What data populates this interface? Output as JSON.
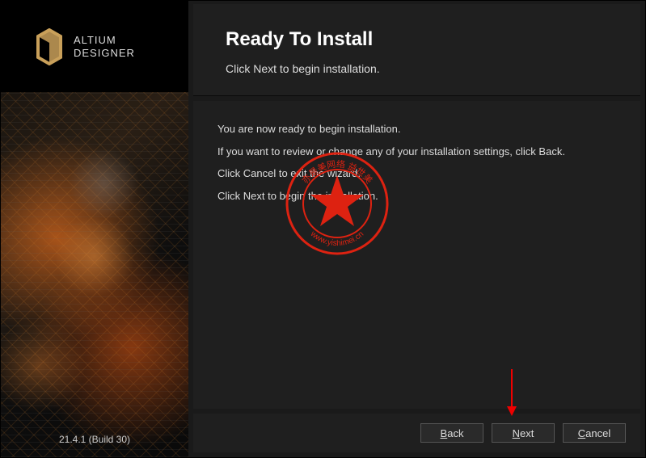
{
  "brand": {
    "line1": "ALTIUM",
    "line2": "DESIGNER"
  },
  "version": "21.4.1 (Build 30)",
  "header": {
    "title": "Ready To Install",
    "subtitle": "Click Next to begin installation."
  },
  "content": {
    "line1": "You are now ready to begin installation.",
    "line2": "If you want to review or change any of your installation settings, click Back.",
    "line3": "Click Cancel to exit the wizard.",
    "line4": "Click Next to begin the installation."
  },
  "buttons": {
    "back": "Back",
    "next": "Next",
    "cancel": "Cancel"
  },
  "stamp": {
    "url_text": "www.yishimei.cn"
  }
}
